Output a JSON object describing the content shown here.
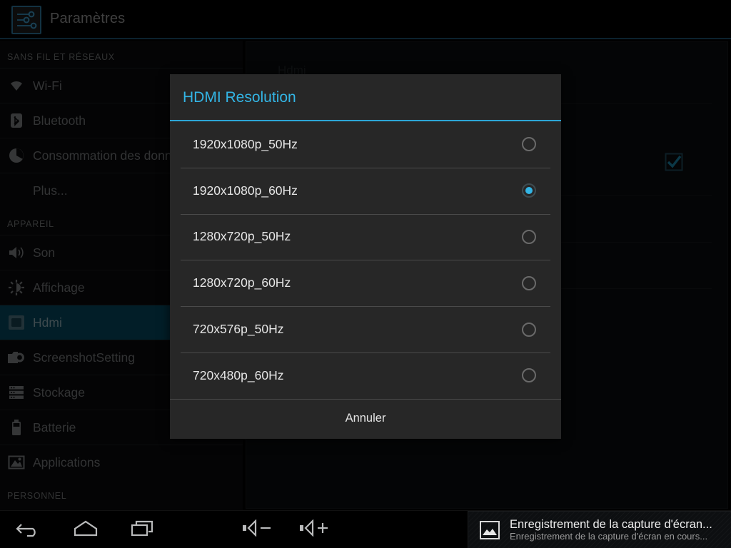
{
  "app": {
    "title": "Paramètres",
    "icon": "settings-sliders-icon"
  },
  "sidebar": {
    "sections": [
      {
        "header": "SANS FIL ET RÉSEAUX",
        "items": [
          {
            "label": "Wi-Fi",
            "icon": "wifi-icon",
            "toggle": true,
            "selected": false
          },
          {
            "label": "Bluetooth",
            "icon": "bluetooth-icon",
            "toggle": true,
            "selected": false
          },
          {
            "label": "Consommation des donn",
            "icon": "data-usage-icon",
            "toggle": false,
            "selected": false
          },
          {
            "label": "Plus...",
            "icon": "none",
            "toggle": false,
            "selected": false
          }
        ]
      },
      {
        "header": "APPAREIL",
        "items": [
          {
            "label": "Son",
            "icon": "sound-icon",
            "toggle": false,
            "selected": false
          },
          {
            "label": "Affichage",
            "icon": "display-icon",
            "toggle": false,
            "selected": false
          },
          {
            "label": "Hdmi",
            "icon": "hdmi-icon",
            "toggle": false,
            "selected": true
          },
          {
            "label": "ScreenshotSetting",
            "icon": "camera-icon",
            "toggle": false,
            "selected": false
          },
          {
            "label": "Stockage",
            "icon": "storage-icon",
            "toggle": false,
            "selected": false
          },
          {
            "label": "Batterie",
            "icon": "battery-icon",
            "toggle": false,
            "selected": false
          },
          {
            "label": "Applications",
            "icon": "applications-icon",
            "toggle": false,
            "selected": false
          }
        ]
      },
      {
        "header": "PERSONNEL",
        "items": []
      }
    ]
  },
  "content": {
    "title": "Hdmi",
    "checkbox_checked": true
  },
  "dialog": {
    "title": "HDMI Resolution",
    "options": [
      {
        "label": "1920x1080p_50Hz",
        "selected": false
      },
      {
        "label": "1920x1080p_60Hz",
        "selected": true
      },
      {
        "label": "1280x720p_50Hz",
        "selected": false
      },
      {
        "label": "1280x720p_60Hz",
        "selected": false
      },
      {
        "label": "720x576p_50Hz",
        "selected": false
      },
      {
        "label": "720x480p_60Hz",
        "selected": false
      }
    ],
    "cancel_label": "Annuler"
  },
  "navbar": {
    "buttons": [
      {
        "name": "back-icon"
      },
      {
        "name": "home-icon"
      },
      {
        "name": "recents-icon"
      },
      {
        "name": "volume-down-icon"
      },
      {
        "name": "volume-up-icon"
      }
    ]
  },
  "notification": {
    "icon": "image-icon",
    "title": "Enregistrement de la capture d'écran...",
    "subtitle": "Enregistrement de la capture d'écran en cours..."
  },
  "colors": {
    "accent": "#33b5e5",
    "selected_row": "#064459",
    "dialog_bg": "#272727",
    "window_bg": "#0a0b0d"
  }
}
